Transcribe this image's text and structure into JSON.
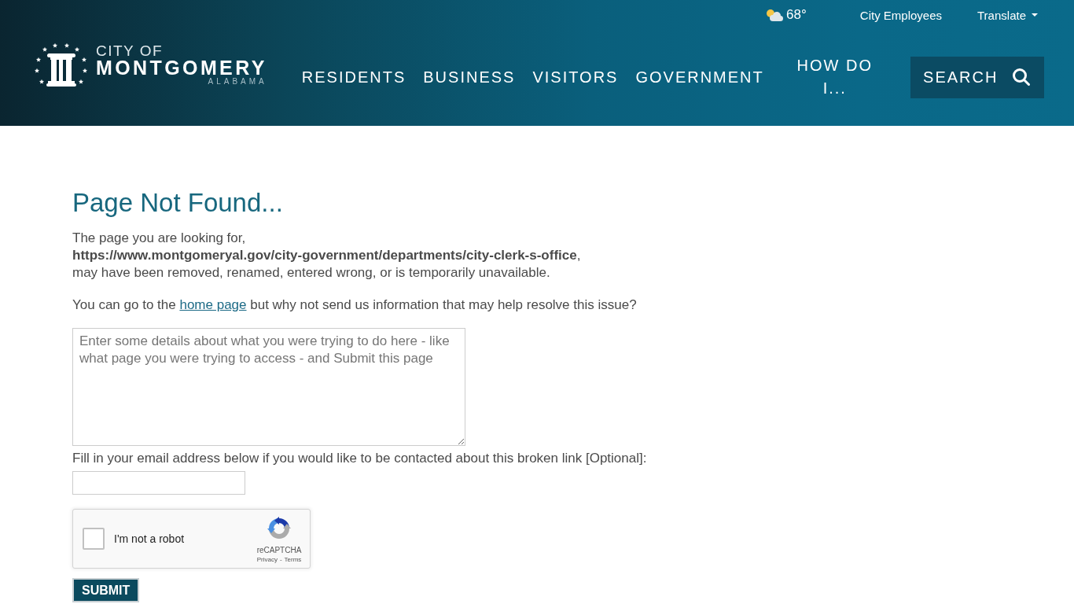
{
  "header": {
    "logo": {
      "line_1": "CITY OF",
      "line_2": "MONTGOMERY",
      "line_3": "ALABAMA"
    },
    "weather": {
      "temperature": "68°"
    },
    "utility_links": [
      {
        "label": "City Employees",
        "kind": "link"
      },
      {
        "label": "Translate",
        "kind": "dropdown"
      }
    ],
    "nav": [
      {
        "label": "RESIDENTS"
      },
      {
        "label": "BUSINESS"
      },
      {
        "label": "VISITORS"
      },
      {
        "label": "GOVERNMENT"
      },
      {
        "label": "HOW DO I..."
      }
    ],
    "search_button": {
      "label": "SEARCH"
    }
  },
  "content": {
    "title": "Page Not Found...",
    "message_lines": [
      "The page you are looking for,",
      "**https://www.montgomeryal.gov/city-government/departments/city-clerk-s-office**,",
      "may have been removed, renamed, entered wrong, or is temporarily unavailable."
    ],
    "help": {
      "before": "You can go to the ",
      "link": "home page",
      "after": " but why not send us information that may help resolve this issue?"
    },
    "details_field": {
      "placeholder": "Enter some details about what you were trying to do here - like what page you were trying to access - and Submit this page"
    },
    "email_label": "Fill in your email address below if you would like to be contacted about this broken link [Optional]:",
    "captcha": {
      "label": "I'm not a robot",
      "checked": false,
      "brand": "reCAPTCHA",
      "links": [
        {
          "label": "Privacy"
        },
        {
          "label": "Terms"
        }
      ],
      "separator": "-"
    },
    "submit_button": {
      "label": "SUBMIT"
    }
  }
}
